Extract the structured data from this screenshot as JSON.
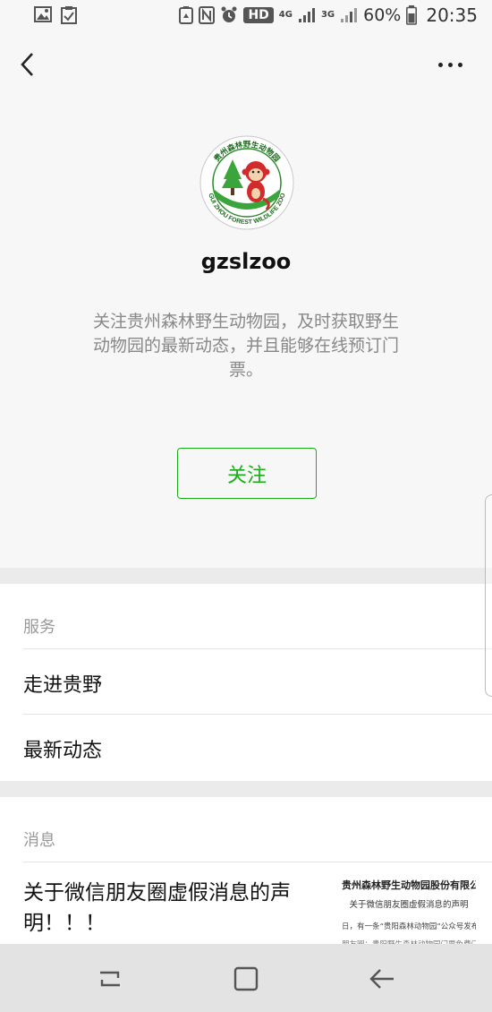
{
  "status_bar": {
    "hd_label": "HD",
    "net_4g": "4G",
    "net_3g": "3G",
    "battery_percent": "60%",
    "time": "20:35"
  },
  "nav": {
    "back_icon": "chevron-left-icon",
    "more_icon": "more-dots-icon"
  },
  "profile": {
    "logo_text_top": "贵州森林野生动物园",
    "logo_text_bottom": "GUI ZHOU FOREST WILDLIFE ZOO",
    "account_name": "gzslzoo",
    "intro": "关注贵州森林野生动物园，及时获取野生动物园的最新动态，并且能够在线预订门票。",
    "follow_label": "关注"
  },
  "services": {
    "title": "服务",
    "items": [
      {
        "label": "走进贵野"
      },
      {
        "label": "最新动态"
      }
    ]
  },
  "messages": {
    "title": "消息",
    "items": [
      {
        "title": "关于微信朋友圈虚假消息的声明！！！",
        "thumb_line1": "贵州森林野生动物园股份有限公司",
        "thumb_line2": "关于微信朋友圈虚假消息的声明",
        "thumb_line3": "日，有一条“贵阳森林动物园”公众号发布",
        "thumb_line4": "朋友圈：贵阳野生森林动物园门票免费门票活动"
      }
    ]
  },
  "colors": {
    "accent_green": "#1aad19",
    "header_bg": "#f7f7f7",
    "gap_bg": "#ebebeb"
  }
}
